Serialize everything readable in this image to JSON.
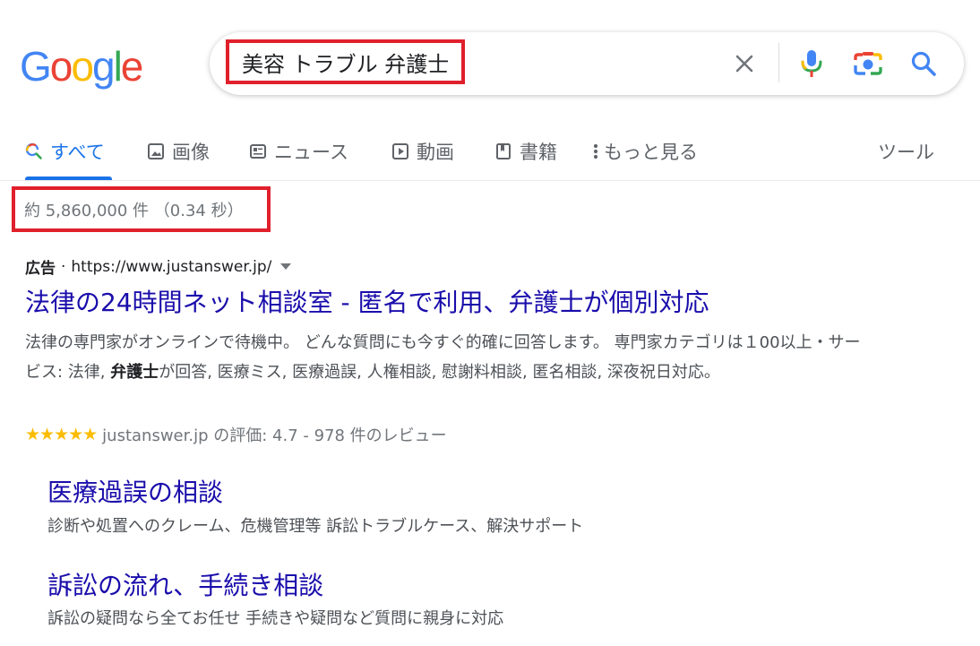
{
  "logo": {
    "letters": [
      "G",
      "o",
      "o",
      "g",
      "l",
      "e"
    ]
  },
  "search": {
    "query": "美容 トラブル 弁護士"
  },
  "tabs": [
    {
      "label": "すべて",
      "icon": "search-icon"
    },
    {
      "label": "画像",
      "icon": "image-icon"
    },
    {
      "label": "ニュース",
      "icon": "news-icon"
    },
    {
      "label": "動画",
      "icon": "video-icon"
    },
    {
      "label": "書籍",
      "icon": "book-icon"
    },
    {
      "label": "もっと見る",
      "icon": "more-vert-icon"
    }
  ],
  "tools_label": "ツール",
  "stats": "約 5,860,000 件 （0.34 秒）",
  "ad": {
    "label": "広告",
    "dot": "·",
    "url": "https://www.justanswer.jp/",
    "title": "法律の24時間ネット相談室 - 匿名で利用、弁護士が個別対応",
    "desc_part1": "法律の専門家がオンラインで待機中。 どんな質問にも今すぐ的確に回答します。 専門家カテゴリは１00以上・サービス: 法律, ",
    "desc_bold": "弁護士",
    "desc_part2": "が回答, 医療ミス, 医療過誤, 人権相談, 慰謝料相談, 匿名相談, 深夜祝日対応。",
    "rating_stars": "★★★★★",
    "rating_value": 4.7,
    "rating_text": "justanswer.jp の評価: 4.7 - 978 件のレビュー"
  },
  "sitelinks": [
    {
      "title": "医療過誤の相談",
      "desc": "診断や処置へのクレーム、危機管理等 訴訟トラブルケース、解決サポート"
    },
    {
      "title": "訴訟の流れ、手続き相談",
      "desc": "訴訟の疑問なら全てお任せ 手続きや疑問など質問に親身に対応"
    }
  ],
  "colors": {
    "link": "#1a0dab",
    "active_tab": "#1a73e8",
    "highlight_box": "#e0202c",
    "star": "#fbbc04"
  }
}
